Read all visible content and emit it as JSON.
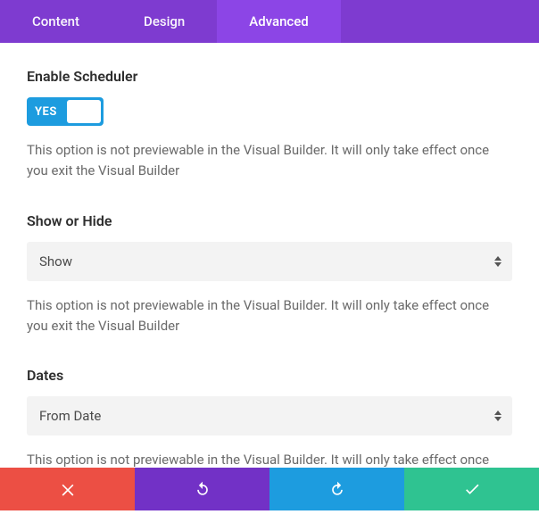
{
  "tabs": {
    "content": "Content",
    "design": "Design",
    "advanced": "Advanced"
  },
  "sections": {
    "scheduler": {
      "title": "Enable Scheduler",
      "toggle_state": "YES",
      "helper": "This option is not previewable in the Visual Builder. It will only take effect once you exit the Visual Builder"
    },
    "show_hide": {
      "title": "Show or Hide",
      "selected": "Show",
      "helper": "This option is not previewable in the Visual Builder. It will only take effect once you exit the Visual Builder"
    },
    "dates": {
      "title": "Dates",
      "selected": "From Date",
      "helper": "This option is not previewable in the Visual Builder. It will only take effect once you exit the Visual Builder"
    }
  }
}
